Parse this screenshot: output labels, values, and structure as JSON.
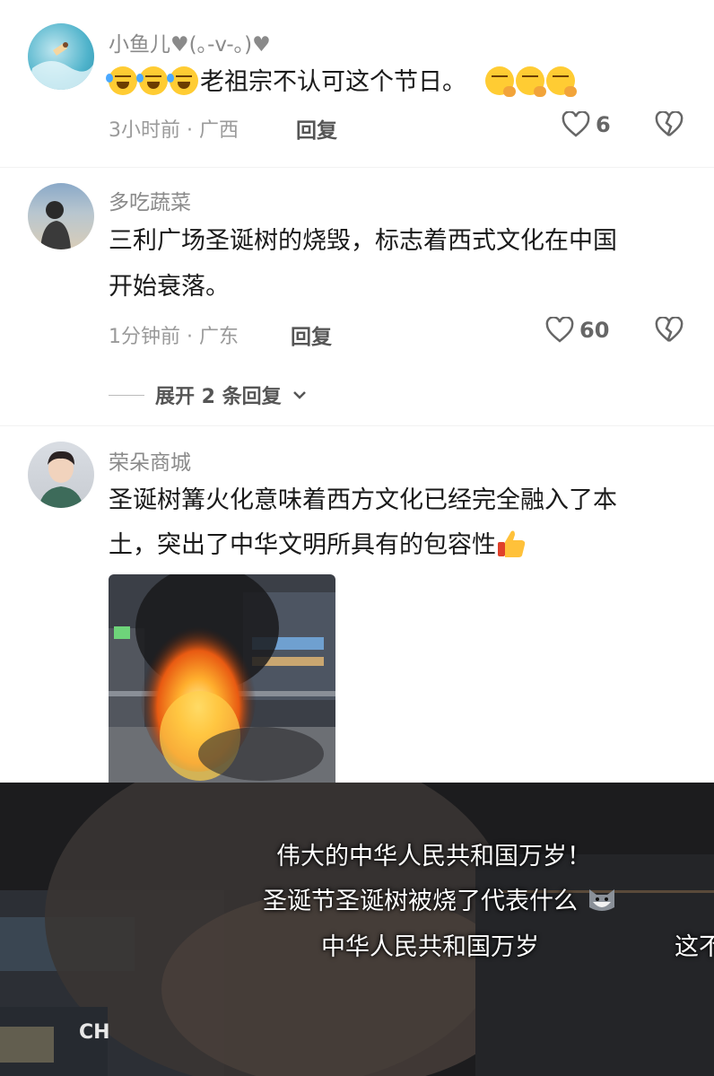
{
  "comments": [
    {
      "username": "小鱼儿♥(｡-v-｡)♥",
      "text": "老祖宗不认可这个节日。",
      "time_location": "3小时前 · 广西",
      "reply_label": "回复",
      "likes": "6",
      "avatar_icon": "surf-ocean-avatar",
      "leading_emoji": "laughing-tears-emoji",
      "trailing_emoji": "hand-over-mouth-emoji"
    },
    {
      "username": "多吃蔬菜",
      "text_line1": "三利广场圣诞树的烧毁，标志着西式文化在中国",
      "text_line2": "开始衰落。",
      "time_location": "1分钟前 · 广东",
      "reply_label": "回复",
      "likes": "60",
      "avatar_icon": "person-beach-avatar",
      "expand_label": "展开 2 条回复"
    },
    {
      "username": "荣朵商城",
      "text_line1": "圣诞树篝火化意味着西方文化已经完全融入了本",
      "text_line2": "土，突出了中华文明所具有的包容性",
      "avatar_icon": "person-portrait-avatar",
      "trailing_emoji": "thumbs-up-emoji",
      "photo": "burning-christmas-tree-photo"
    }
  ],
  "video": {
    "subtitle_line1": "伟大的中华人民共和国万岁！",
    "subtitle_line2": "圣诞节圣诞树被烧了代表什么",
    "subtitle_line3": "中华人民共和国万岁",
    "subtitle_line3_overflow": "这不",
    "sign_text": "CH",
    "sticker_icon": "cat-face-sticker"
  },
  "colors": {
    "fire_orange": "#ff8a1f",
    "accent_yellow": "#ffcc33",
    "muted_text": "#9a9a9a"
  }
}
